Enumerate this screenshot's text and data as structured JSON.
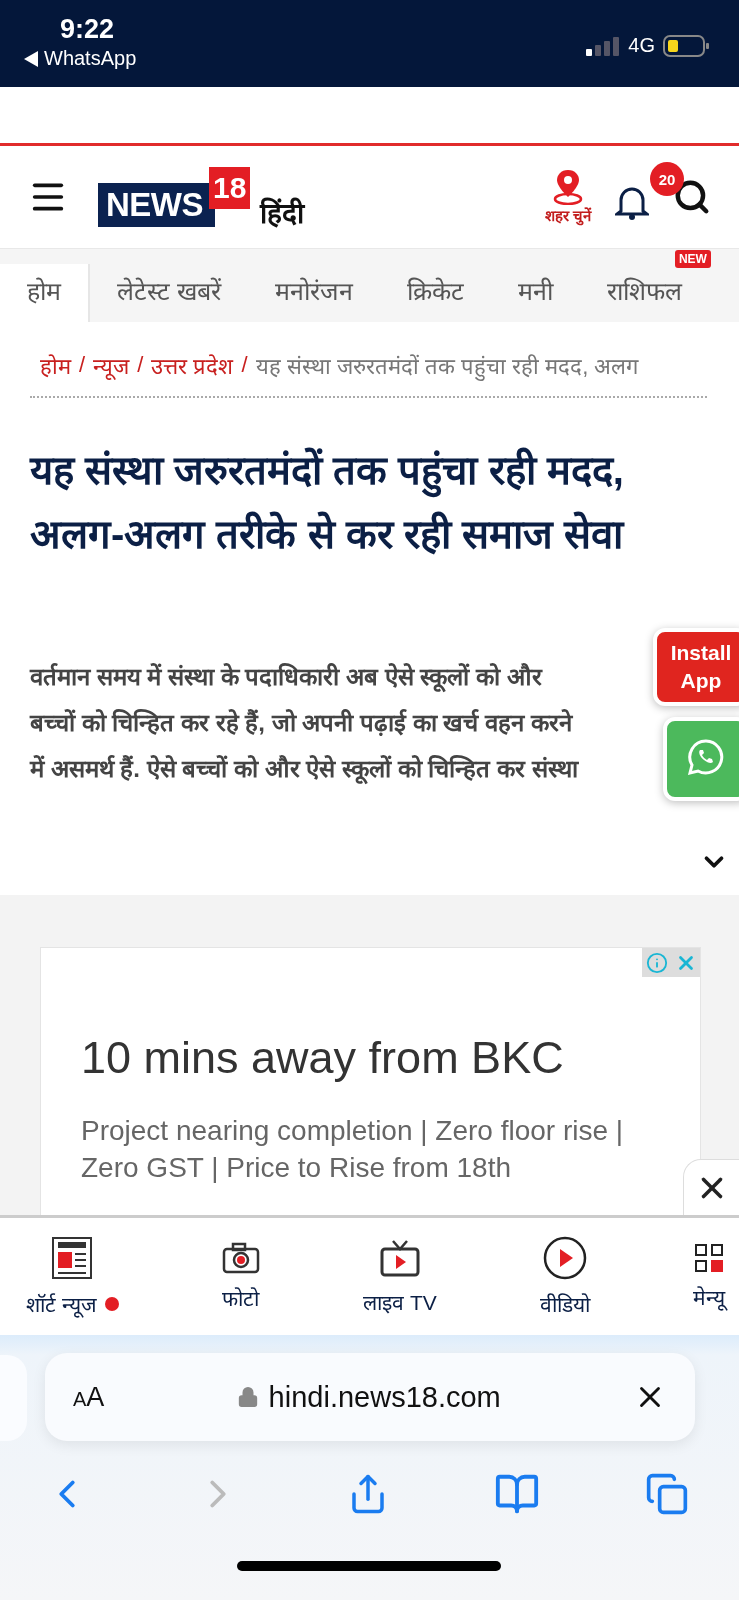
{
  "status_bar": {
    "time": "9:22",
    "back_label": "WhatsApp",
    "network": "4G"
  },
  "header": {
    "logo_word": "NEWS",
    "logo_number": "18",
    "logo_language": "हिंदी",
    "city_label": "शहर चुनें",
    "notification_count": "20"
  },
  "nav_tabs": [
    {
      "label": "होम",
      "selected": true
    },
    {
      "label": "लेटेस्ट खबरें",
      "selected": false
    },
    {
      "label": "मनोरंजन",
      "selected": false
    },
    {
      "label": "क्रिकेट",
      "selected": false
    },
    {
      "label": "मनी",
      "selected": false
    },
    {
      "label": "राशिफल",
      "selected": false,
      "badge": "NEW"
    }
  ],
  "breadcrumb_separator": "/",
  "breadcrumb": [
    {
      "label": "होम",
      "kind": "link"
    },
    {
      "label": "न्यूज",
      "kind": "link"
    },
    {
      "label": "उत्तर प्रदेश",
      "kind": "link"
    },
    {
      "label": "यह संस्था जरुरतमंदों तक पहुंचा रही मदद, अलग",
      "kind": "current"
    }
  ],
  "headline": "यह संस्था जरुरतमंदों तक पहुंचा रही मदद, अलग-अलग तरीके से कर रही समाज सेवा",
  "install_app": "Install App",
  "paragraph_lines": [
    "वर्तमान समय में संस्था के पदाधिकारी अब ऐसे स्कूलों को और",
    "बच्चों को चिन्हित कर रहे हैं, जो अपनी पढ़ाई का खर्च वहन करने",
    "में असमर्थ हैं. ऐसे बच्चों को और ऐसे स्कूलों को चिन्हित कर संस्था"
  ],
  "ad": {
    "headline": "10 mins away from BKC",
    "description": "Project nearing completion | Zero floor rise | Zero GST | Price to Rise from 18th"
  },
  "bottom_nav": [
    {
      "label": "शॉर्ट न्यूज",
      "kind": "short-news",
      "dot": true
    },
    {
      "label": "फोटो",
      "kind": "photo",
      "dot": false
    },
    {
      "label": "लाइव TV",
      "kind": "live-tv",
      "dot": false
    },
    {
      "label": "वीडियो",
      "kind": "video",
      "dot": false
    },
    {
      "label": "मेन्यू",
      "kind": "menu",
      "dot": false
    }
  ],
  "browser": {
    "text_size": "AA",
    "url": "hindi.news18.com"
  }
}
